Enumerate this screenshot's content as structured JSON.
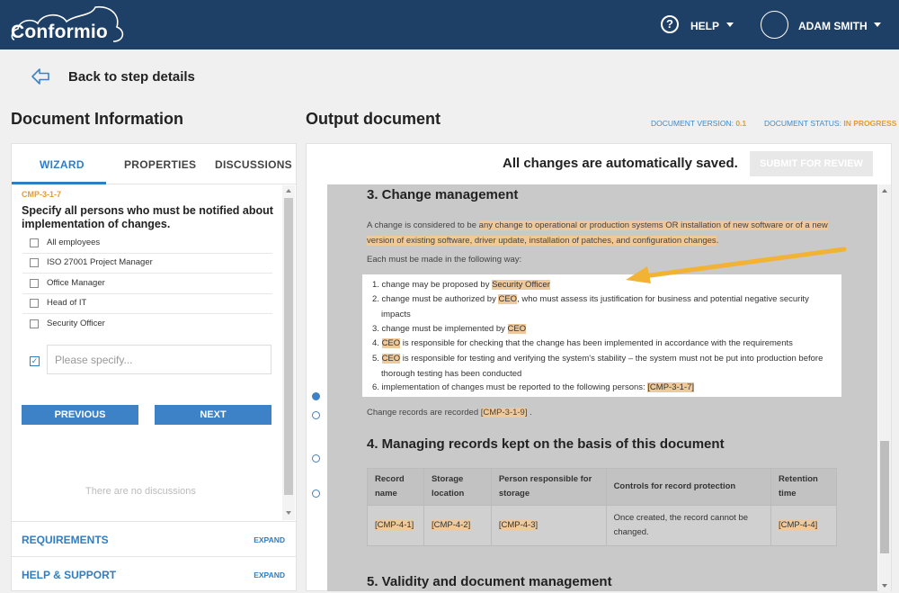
{
  "header": {
    "logo_text": "Conformio",
    "help_label": "HELP",
    "user_name": "ADAM SMITH"
  },
  "nav": {
    "back_label": "Back to step details"
  },
  "left": {
    "title": "Document Information",
    "tabs": [
      "WIZARD",
      "PROPERTIES",
      "DISCUSSIONS"
    ],
    "wizard": {
      "code": "CMP-3-1-7",
      "question": "Specify all persons who must be notified about implementation of changes.",
      "options": [
        "All employees",
        "ISO 27001 Project Manager",
        "Office Manager",
        "Head of IT",
        "Security Officer"
      ],
      "specify_placeholder": "Please specify...",
      "previous_label": "PREVIOUS",
      "next_label": "NEXT",
      "no_discussions": "There are no discussions"
    },
    "accordion": [
      {
        "label": "REQUIREMENTS",
        "action": "EXPAND"
      },
      {
        "label": "HELP & SUPPORT",
        "action": "EXPAND"
      }
    ]
  },
  "right": {
    "title": "Output document",
    "version_label": "DOCUMENT VERSION:",
    "version_value": "0.1",
    "status_label": "DOCUMENT STATUS:",
    "status_value": "IN PROGRESS",
    "saved_message": "All changes are automatically saved.",
    "submit_label": "SUBMIT FOR REVIEW"
  },
  "document": {
    "sec3_title": "3. Change management",
    "p1_a": "A change is considered to be ",
    "p1_hl": "any change to operational or production systems OR installation of new software or of a new version of existing software, driver update, installation of patches, and configuration changes",
    "p1_b": ".",
    "p2": "Each must be made in the following way:",
    "list": {
      "i1_a": "1. change may be proposed by ",
      "i1_hl": "Security Officer",
      "i2_a": "2. change must be authorized by ",
      "i2_hl": "CEO",
      "i2_b": ", who must assess its justification for business and potential negative security impacts",
      "i3_a": "3. change must be implemented by ",
      "i3_hl": "CEO",
      "i4_a": "4. ",
      "i4_hl": "CEO",
      "i4_b": " is responsible for checking that the change has been implemented in accordance with the requirements",
      "i5_a": "5. ",
      "i5_hl": "CEO",
      "i5_b": " is responsible for testing and verifying the system's stability – the system must not be put into production before thorough testing has been conducted",
      "i6_a": "6. implementation of changes must be reported to the following persons: ",
      "i6_hl": "[CMP-3-1-7]"
    },
    "p3_a": "Change records are recorded ",
    "p3_hl": "[CMP-3-1-9]",
    "p3_b": " .",
    "sec4_title": "4. Managing records kept on the basis of this document",
    "table": {
      "headers": [
        "Record name",
        "Storage location",
        "Person responsible for storage",
        "Controls for record protection",
        "Retention time"
      ],
      "row": [
        "[CMP-4-1]",
        "[CMP-4-2]",
        "[CMP-4-3]",
        "Once created, the record cannot be changed.",
        "[CMP-4-4]"
      ]
    },
    "sec5_title": "5. Validity and document management"
  },
  "colors": {
    "header_bg": "#1e3f66",
    "accent": "#2e7ec5",
    "orange": "#e89b2c",
    "highlight": "#efc99a"
  }
}
